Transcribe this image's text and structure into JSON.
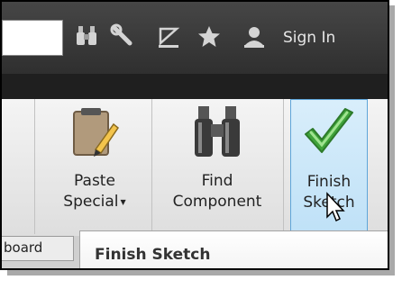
{
  "toolbar": {
    "search_value": "",
    "icons": [
      "binoculars-icon",
      "wrench-icon",
      "satellite-icon",
      "star-icon",
      "user-icon"
    ],
    "sign_in_label": "Sign In"
  },
  "ribbon": {
    "buttons": [
      {
        "line1": "Paste",
        "line2": "Special",
        "has_dropdown": true,
        "icon": "clipboard-pencil-icon"
      },
      {
        "line1": "Find",
        "line2": "Component",
        "icon": "binoculars-icon"
      },
      {
        "line1": "Finish",
        "line2": "Sketch",
        "icon": "checkmark-icon",
        "state": "hover"
      }
    ],
    "panel_tab_label": "board",
    "tooltip_title": "Finish Sketch"
  },
  "colors": {
    "accent_green": "#3fa33a",
    "hover_blue": "#bfe1f7"
  }
}
